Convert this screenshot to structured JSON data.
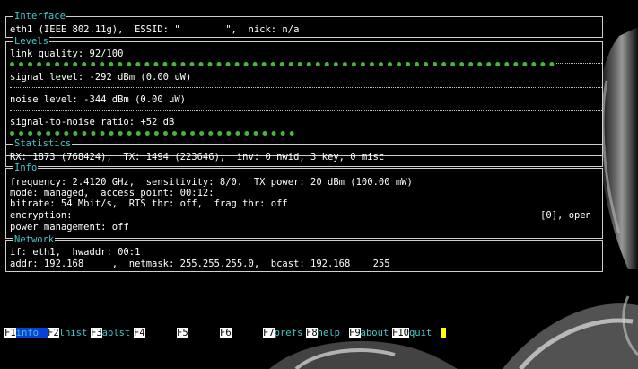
{
  "interface": {
    "title": "Interface",
    "line": "eth1 (IEEE 802.11g),  ESSID: \"        \",  nick: n/a"
  },
  "levels": {
    "title": "Levels",
    "link_quality": "link quality: 92/100",
    "link_quality_value": 0.92,
    "signal_level": "signal level: -292 dBm (0.00 uW)",
    "noise_level": "noise level: -344 dBm (0.00 uW)",
    "snr": "signal-to-noise ratio: +52 dB",
    "snr_value": 0.48,
    "bar_color": "#46b636"
  },
  "statistics": {
    "title": "Statistics",
    "line": "RX: 1873 (768424),  TX: 1494 (223646),  inv: 0 nwid, 3 key, 0 misc"
  },
  "info": {
    "title": "Info",
    "line1": "frequency: 2.4120 GHz,  sensitivity: 8/0.  TX power: 20 dBm (100.00 mW)",
    "line2": "mode: managed,  access point: 00:12:",
    "line3": "bitrate: 54 Mbit/s,  RTS thr: off,  frag thr: off",
    "line4_left": "encryption:",
    "line4_right": "[0], open",
    "line5": "power management: off"
  },
  "network": {
    "title": "Network",
    "line1": "if: eth1,  hwaddr: 00:1",
    "line2": "addr: 192.168     ,  netmask: 255.255.255.0,  bcast: 192.168    255"
  },
  "footer": {
    "keys": [
      {
        "key": "F1",
        "label": "info"
      },
      {
        "key": "F2",
        "label": "lhist"
      },
      {
        "key": "F3",
        "label": "aplst"
      },
      {
        "key": "F4",
        "label": ""
      },
      {
        "key": "F5",
        "label": ""
      },
      {
        "key": "F6",
        "label": ""
      },
      {
        "key": "F7",
        "label": "prefs"
      },
      {
        "key": "F8",
        "label": "help"
      },
      {
        "key": "F9",
        "label": "about"
      },
      {
        "key": "F10",
        "label": "quit"
      }
    ],
    "active_key": "F1",
    "cursor_color": "#ffff00"
  }
}
